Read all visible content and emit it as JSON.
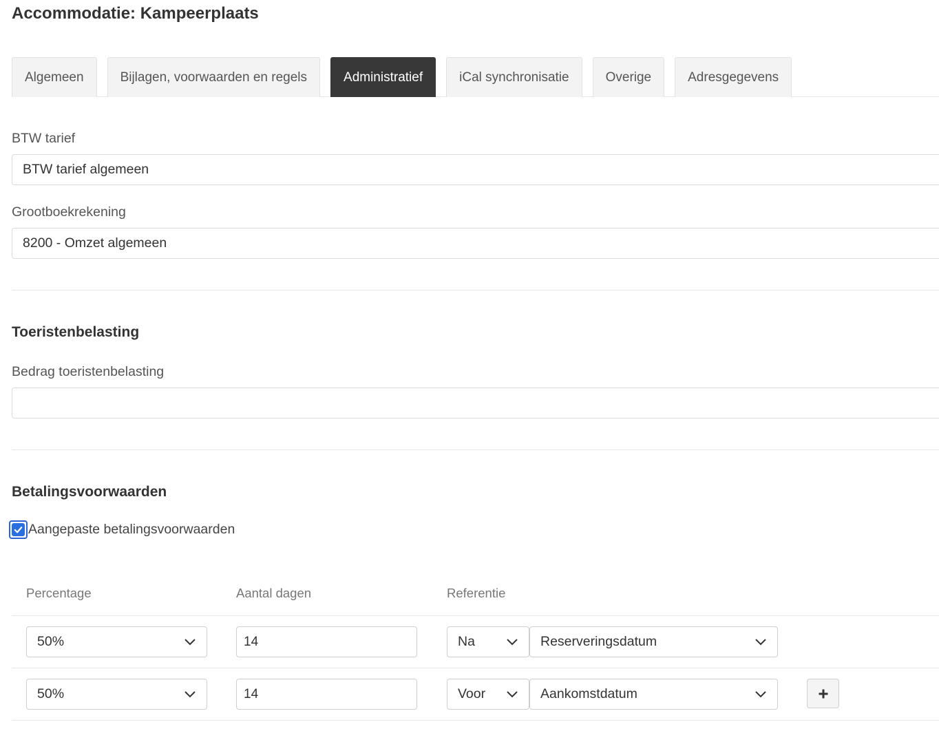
{
  "page": {
    "title": "Accommodatie: Kampeerplaats"
  },
  "tabs": [
    {
      "label": "Algemeen",
      "active": false
    },
    {
      "label": "Bijlagen, voorwaarden en regels",
      "active": false
    },
    {
      "label": "Administratief",
      "active": true
    },
    {
      "label": "iCal synchronisatie",
      "active": false
    },
    {
      "label": "Overige",
      "active": false
    },
    {
      "label": "Adresgegevens",
      "active": false
    }
  ],
  "btw": {
    "label": "BTW tarief",
    "value": "BTW tarief algemeen"
  },
  "grootboek": {
    "label": "Grootboekrekening",
    "value": "8200 - Omzet algemeen"
  },
  "toeristenbelasting": {
    "title": "Toeristenbelasting",
    "label": "Bedrag toeristenbelasting",
    "value": ""
  },
  "betalingsvoorwaarden": {
    "title": "Betalingsvoorwaarden",
    "checkbox_label": "Aangepaste betalingsvoorwaarden",
    "checked": true,
    "headers": {
      "percentage": "Percentage",
      "dagen": "Aantal dagen",
      "referentie": "Referentie"
    },
    "rows": [
      {
        "percentage": "50%",
        "dagen": "14",
        "richting": "Na",
        "referentie": "Reserveringsdatum"
      },
      {
        "percentage": "50%",
        "dagen": "14",
        "richting": "Voor",
        "referentie": "Aankomstdatum"
      }
    ]
  },
  "colors": {
    "active_tab": "#383838",
    "checkbox": "#2a6fe0"
  },
  "icons": {
    "dropdown": "chevron-down-icon",
    "add": "plus-icon",
    "check": "check-icon"
  }
}
